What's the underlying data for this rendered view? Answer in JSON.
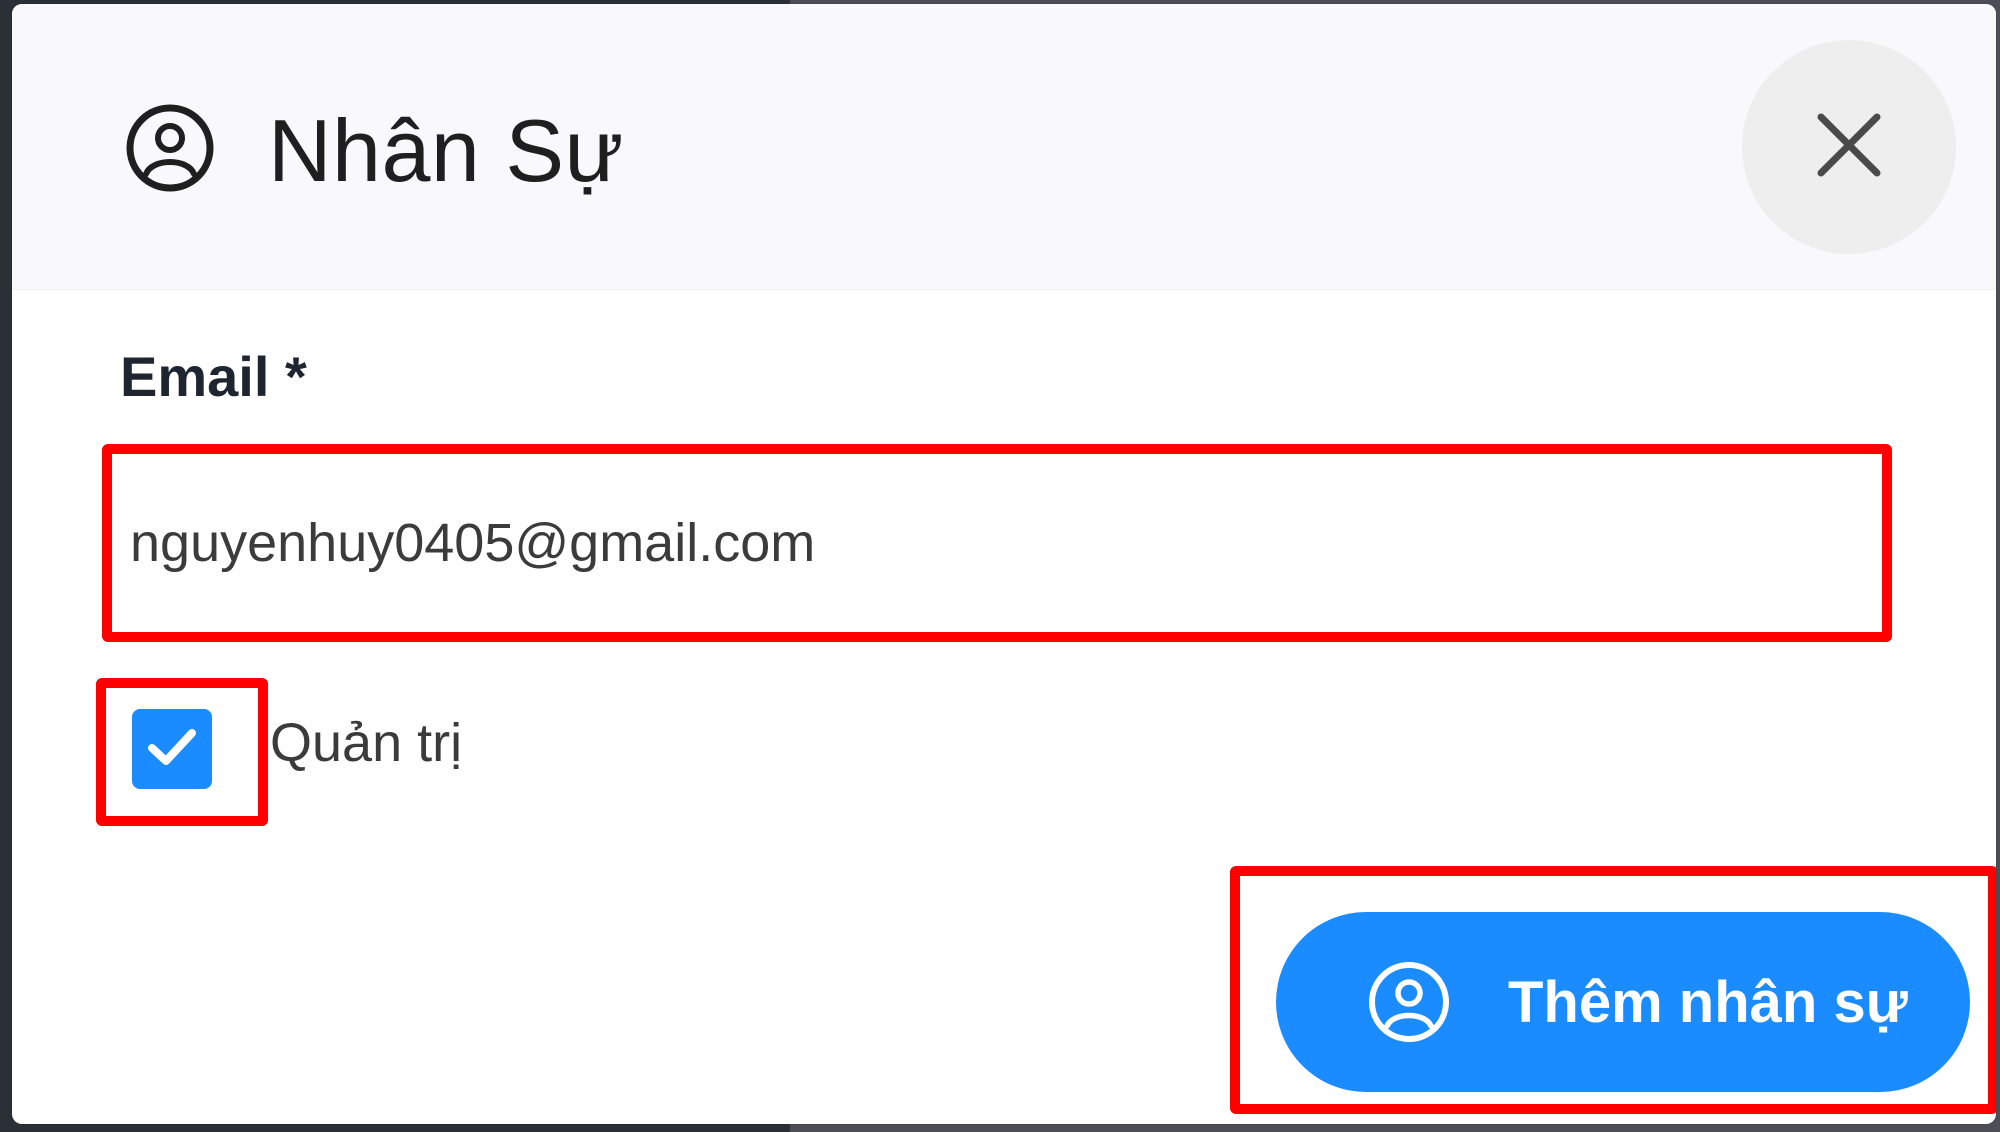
{
  "modal": {
    "title": "Nhân Sự",
    "icon": "user-circle-icon",
    "close_icon": "close-icon"
  },
  "form": {
    "email_label": "Email *",
    "email_value": "nguyenhuy0405@gmail.com",
    "admin_checkbox": {
      "label": "Quản trị",
      "checked": true
    }
  },
  "actions": {
    "add_label": "Thêm nhân sự",
    "add_icon": "user-circle-icon"
  },
  "colors": {
    "accent": "#1a8cff",
    "highlight": "#ff0000",
    "header_bg": "#f9f9fb",
    "close_bg": "#eeeeee"
  }
}
